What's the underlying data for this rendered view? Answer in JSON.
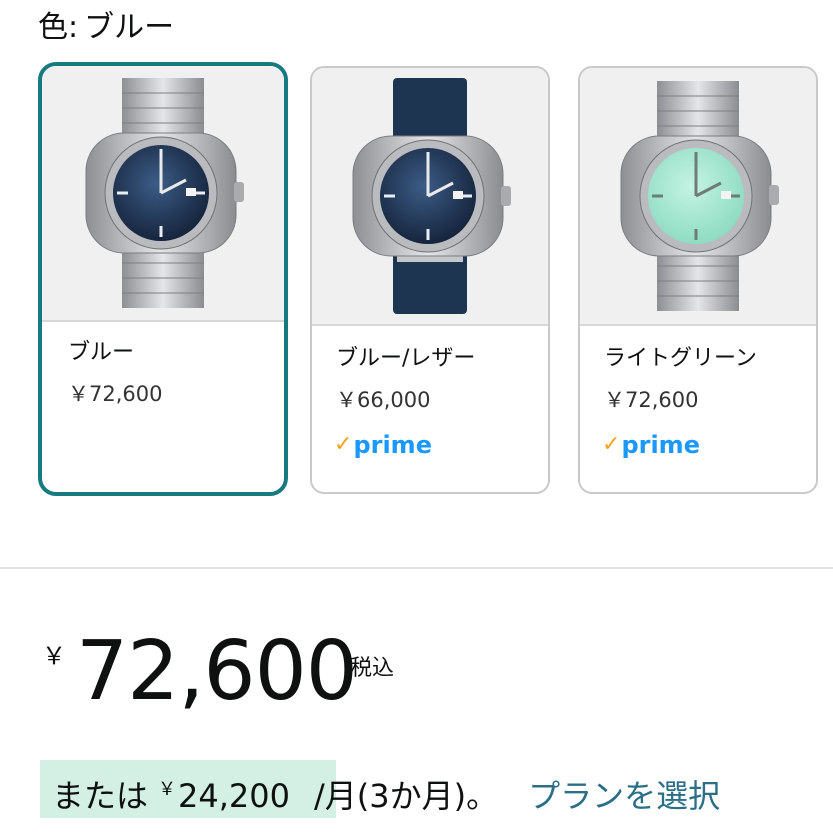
{
  "variation": {
    "label_prefix": "色:",
    "selected_value": "ブルー"
  },
  "options": [
    {
      "name": "ブルー",
      "price": "￥72,600",
      "prime": false,
      "selected": true,
      "dial_color": "#1d2f4d",
      "strap": "metal bracelet"
    },
    {
      "name": "ブルー/レザー",
      "price": "￥66,000",
      "prime": true,
      "selected": false,
      "dial_color": "#1d2f4d",
      "strap": "blue leather"
    },
    {
      "name": "ライトグリーン",
      "price": "￥72,600",
      "prime": true,
      "selected": false,
      "dial_color": "#9fe3cc",
      "strap": "metal bracelet"
    }
  ],
  "prime_badge": {
    "check": "✓",
    "text": "prime"
  },
  "price": {
    "currency_symbol": "￥",
    "value": "72,600",
    "tax_label": "税込"
  },
  "installment": {
    "prefix": "または",
    "currency_symbol": "￥",
    "amount": "24,200",
    "suffix": "/月(3か月)。",
    "link_text": "プランを選択"
  },
  "colors": {
    "selected_border": "#177a80",
    "prime_blue": "#1a98ff",
    "prime_check": "#f7a31a",
    "link": "#2b6f86",
    "highlight": "#d4efe4"
  }
}
